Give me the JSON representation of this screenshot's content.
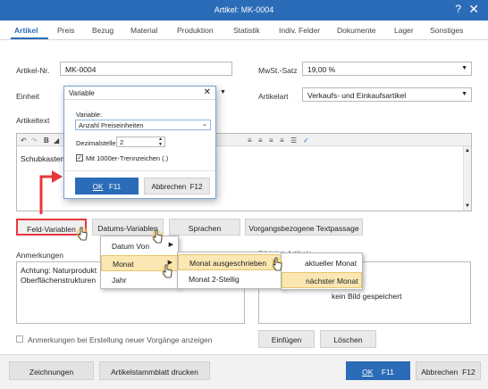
{
  "window": {
    "title": "Artikel: MK-0004",
    "help": "?",
    "close": "✕"
  },
  "tabs": [
    {
      "label": "Artikel",
      "active": true
    },
    {
      "label": "Preis"
    },
    {
      "label": "Bezug"
    },
    {
      "label": "Material"
    },
    {
      "label": "Produktion"
    },
    {
      "label": "Statistik"
    },
    {
      "label": "Indiv. Felder"
    },
    {
      "label": "Dokumente"
    },
    {
      "label": "Lager"
    },
    {
      "label": "Sonstiges"
    }
  ],
  "form": {
    "artikel_nr_label": "Artikel-Nr.",
    "artikel_nr_value": "MK-0004",
    "einheit_label": "Einheit",
    "mwst_label": "MwSt.-Satz",
    "mwst_value": "19,00 %",
    "artikelart_label": "Artikelart",
    "artikelart_value": "Verkaufs- und Einkaufsartikel",
    "artikeltext_label": "Artikeltext",
    "artikeltext_value": "Schubkastenvo",
    "anmerkungen_label": "Anmerkungen",
    "anmerkungen_text_1": "Achtung: Naturprodukt",
    "anmerkungen_text_2": "Oberflächenstrukturen",
    "bild_label": "Bild des Artikels",
    "bild_placeholder": "kein Bild gespeichert",
    "checkbox_label": "Anmerkungen bei Erstellung neuer Vorgänge anzeigen"
  },
  "editor_buttons": {
    "feld_variablen": "Feld-Variablen",
    "datums_variablen": "Datums-Variablen",
    "sprachen": "Sprachen",
    "vorgang_textpassage": "Vorgangsbezogene Textpassage"
  },
  "image_buttons": {
    "einfuegen": "Einfügen",
    "loeschen": "Löschen"
  },
  "footer": {
    "zeichnungen": "Zeichnungen",
    "artikelstammblatt": "Artikelstammblatt drucken",
    "ok": "OK",
    "ok_key": "F11",
    "abbrechen": "Abbrechen",
    "abbrechen_key": "F12"
  },
  "variable_dialog": {
    "title": "Variable",
    "variable_label": "Variable:",
    "variable_value": "Anzahl Preiseinheiten",
    "dezimal_label": "Dezimalstellen:",
    "dezimal_value": "2",
    "tausender_label": "Mit 1000er-Trennzeichen (.)",
    "ok": "OK",
    "ok_key": "F11",
    "abbrechen": "Abbrechen",
    "abbrechen_key": "F12"
  },
  "menu1": [
    "Datum Von",
    "Monat",
    "Jahr"
  ],
  "menu2": [
    "Monat ausgeschrieben",
    "Monat 2-Stellig"
  ],
  "menu3": [
    "aktueller Monat",
    "nächster Monat"
  ],
  "colors": {
    "accent": "#2b6cb8",
    "highlight": "#fbe7b3",
    "callout": "#e8383d"
  }
}
